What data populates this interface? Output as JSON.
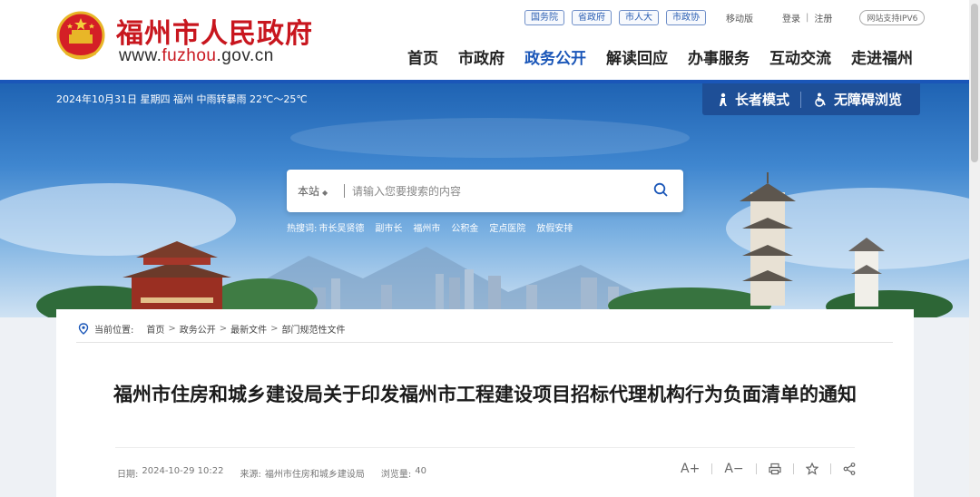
{
  "header": {
    "site_name": "福州市人民政府",
    "domain_prefix": "www.",
    "domain_brand": "fuzhou",
    "domain_suffix": ".gov.cn",
    "top_pills": [
      "国务院",
      "省政府",
      "市人大",
      "市政协"
    ],
    "mobile_version": "移动版",
    "login": "登录",
    "register": "注册",
    "ipv6": "网站支持IPV6",
    "nav": [
      "首页",
      "市政府",
      "政务公开",
      "解读回应",
      "办事服务",
      "互动交流",
      "走进福州"
    ],
    "active_nav": "政务公开",
    "accent_color": "#c8161e",
    "nav_active_color": "#1a56b8"
  },
  "banner": {
    "weather": "2024年10月31日 星期四  福州 中雨转暴雨 22℃～25℃",
    "elder_mode": "长者模式",
    "accessible": "无障碍浏览",
    "search": {
      "scope": "本站",
      "placeholder": "请输入您要搜索的内容"
    },
    "hot_label": "热搜词:",
    "hot_words": [
      "市长吴贤德",
      "副市长",
      "福州市",
      "公积金",
      "定点医院",
      "放假安排"
    ]
  },
  "breadcrumb": {
    "label": "当前位置:",
    "items": [
      "首页",
      "政务公开",
      "最新文件",
      "部门规范性文件"
    ]
  },
  "article": {
    "title": "福州市住房和城乡建设局关于印发福州市工程建设项目招标代理机构行为负面清单的通知",
    "date_label": "日期:",
    "date": "2024-10-29 10:22",
    "source_label": "来源:",
    "source": "福州市住房和城乡建设局",
    "views_label": "浏览量:",
    "views": "40",
    "tools": {
      "font_larger": "A+",
      "font_smaller": "A−"
    }
  }
}
